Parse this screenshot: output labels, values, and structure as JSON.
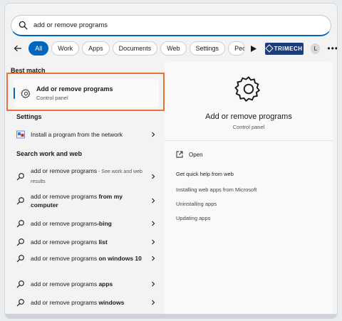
{
  "search": {
    "value": "add or remove programs"
  },
  "filters": {
    "chips": [
      "All",
      "Work",
      "Apps",
      "Documents",
      "Web",
      "Settings",
      "Peo"
    ],
    "brand_label": "TRIMECH",
    "avatar_letter": "L",
    "more_label": "•••"
  },
  "best_match": {
    "section_title": "Best match",
    "title": "Add or remove programs",
    "subtitle": "Control panel",
    "icon": "gear-icon"
  },
  "settings_section": {
    "title": "Settings",
    "items": [
      {
        "label": "Install a program from the network",
        "icon": "control-panel-icon"
      }
    ]
  },
  "web_section": {
    "title": "Search work and web",
    "items": [
      {
        "text": "add or remove programs",
        "bold": "",
        "hint": " - See work and web results"
      },
      {
        "text": "add or remove programs ",
        "bold": "from my computer",
        "hint": ""
      },
      {
        "text": "add or remove programs",
        "bold": "-bing",
        "hint": ""
      },
      {
        "text": "add or remove programs ",
        "bold": "list",
        "hint": ""
      },
      {
        "text": "add or remove programs ",
        "bold": "on windows 10",
        "hint": ""
      },
      {
        "text": "add or remove programs ",
        "bold": "apps",
        "hint": ""
      },
      {
        "text": "add or remove programs ",
        "bold": "windows",
        "hint": ""
      }
    ]
  },
  "preview": {
    "title": "Add or remove programs",
    "subtitle": "Control panel",
    "open_label": "Open",
    "help_title": "Get quick help from web",
    "help_links": [
      "Installing web apps from Microsoft",
      "Uninstalling apps",
      "Updating apps"
    ]
  },
  "colors": {
    "accent": "#0067c0",
    "highlight_box": "#e8733a",
    "brand_bg": "#1c3d7a"
  }
}
